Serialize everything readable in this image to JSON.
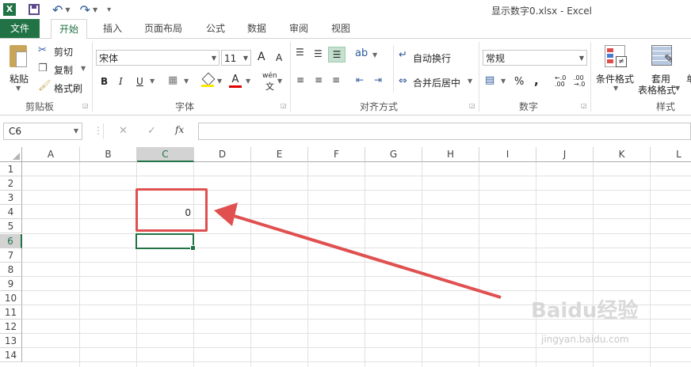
{
  "window": {
    "title": "显示数字0.xlsx - Excel"
  },
  "qat": {
    "excel_icon": "X",
    "save_icon": "save-icon",
    "undo_icon": "↶",
    "redo_icon": "↷",
    "customize_icon": "▾"
  },
  "tabs": [
    {
      "label": "文件"
    },
    {
      "label": "开始"
    },
    {
      "label": "插入"
    },
    {
      "label": "页面布局"
    },
    {
      "label": "公式"
    },
    {
      "label": "数据"
    },
    {
      "label": "审阅"
    },
    {
      "label": "视图"
    }
  ],
  "ribbon": {
    "clipboard": {
      "paste": "粘贴",
      "cut": "剪切",
      "copy": "复制",
      "format_painter": "格式刷",
      "group": "剪贴板"
    },
    "font": {
      "name": "宋体",
      "size": "11",
      "bold": "B",
      "italic": "I",
      "underline": "U",
      "grow": "A",
      "shrink": "A",
      "font_color": "A",
      "wen": "wén",
      "group": "字体"
    },
    "align": {
      "wrap": "自动换行",
      "merge": "合并后居中",
      "group": "对齐方式"
    },
    "number": {
      "format": "常规",
      "percent": "%",
      "comma": ",",
      "group": "数字"
    },
    "styles": {
      "cond_format": "条件格式",
      "table_format_1": "套用",
      "table_format_2": "表格格式",
      "group": "样式"
    }
  },
  "formula_bar": {
    "name_box": "C6",
    "cancel": "✕",
    "enter": "✓",
    "fx": "fx",
    "value": ""
  },
  "grid": {
    "columns": [
      "A",
      "B",
      "C",
      "D",
      "E",
      "F",
      "G",
      "H",
      "I",
      "J",
      "K",
      "L"
    ],
    "rows": [
      "1",
      "2",
      "3",
      "4",
      "5",
      "6",
      "7",
      "8",
      "9",
      "10",
      "11",
      "12",
      "13",
      "14"
    ],
    "selected_column": "C",
    "selected_row": "6",
    "cells": {
      "C4": "0"
    }
  },
  "annotation": {
    "color": "#e05050"
  },
  "watermark": {
    "line1": "Baidu经验",
    "line2": "jingyan.baidu.com"
  }
}
